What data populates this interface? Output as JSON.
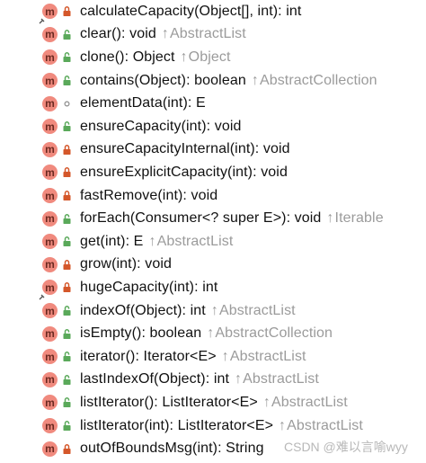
{
  "colors": {
    "method_icon_bg": "#f08a7e",
    "method_icon_fg": "#6b2a21",
    "lock_private": "#d4572a",
    "lock_public": "#5aa95a",
    "owner_text": "#9b9b9b",
    "watermark": "#b8b8b8"
  },
  "method_icon_letter": "m",
  "inherited_arrow": "↑",
  "methods": [
    {
      "signature": "calculateCapacity(Object[], int): int",
      "owner": "",
      "visibility": "private",
      "static": true
    },
    {
      "signature": "clear(): void",
      "owner": "AbstractList",
      "visibility": "public",
      "static": false
    },
    {
      "signature": "clone(): Object",
      "owner": "Object",
      "visibility": "public",
      "static": false
    },
    {
      "signature": "contains(Object): boolean",
      "owner": "AbstractCollection",
      "visibility": "public",
      "static": false
    },
    {
      "signature": "elementData(int): E",
      "owner": "",
      "visibility": "package",
      "static": false
    },
    {
      "signature": "ensureCapacity(int): void",
      "owner": "",
      "visibility": "public",
      "static": false
    },
    {
      "signature": "ensureCapacityInternal(int): void",
      "owner": "",
      "visibility": "private",
      "static": false
    },
    {
      "signature": "ensureExplicitCapacity(int): void",
      "owner": "",
      "visibility": "private",
      "static": false
    },
    {
      "signature": "fastRemove(int): void",
      "owner": "",
      "visibility": "private",
      "static": false
    },
    {
      "signature": "forEach(Consumer<? super E>): void",
      "owner": "Iterable",
      "visibility": "public",
      "static": false
    },
    {
      "signature": "get(int): E",
      "owner": "AbstractList",
      "visibility": "public",
      "static": false
    },
    {
      "signature": "grow(int): void",
      "owner": "",
      "visibility": "private",
      "static": false
    },
    {
      "signature": "hugeCapacity(int): int",
      "owner": "",
      "visibility": "private",
      "static": true
    },
    {
      "signature": "indexOf(Object): int",
      "owner": "AbstractList",
      "visibility": "public",
      "static": false
    },
    {
      "signature": "isEmpty(): boolean",
      "owner": "AbstractCollection",
      "visibility": "public",
      "static": false
    },
    {
      "signature": "iterator(): Iterator<E>",
      "owner": "AbstractList",
      "visibility": "public",
      "static": false
    },
    {
      "signature": "lastIndexOf(Object): int",
      "owner": "AbstractList",
      "visibility": "public",
      "static": false
    },
    {
      "signature": "listIterator(): ListIterator<E>",
      "owner": "AbstractList",
      "visibility": "public",
      "static": false
    },
    {
      "signature": "listIterator(int): ListIterator<E>",
      "owner": "AbstractList",
      "visibility": "public",
      "static": false
    },
    {
      "signature": "outOfBoundsMsg(int): String",
      "owner": "",
      "visibility": "private",
      "static": false
    }
  ],
  "watermark": "CSDN @难以言喻wyy"
}
